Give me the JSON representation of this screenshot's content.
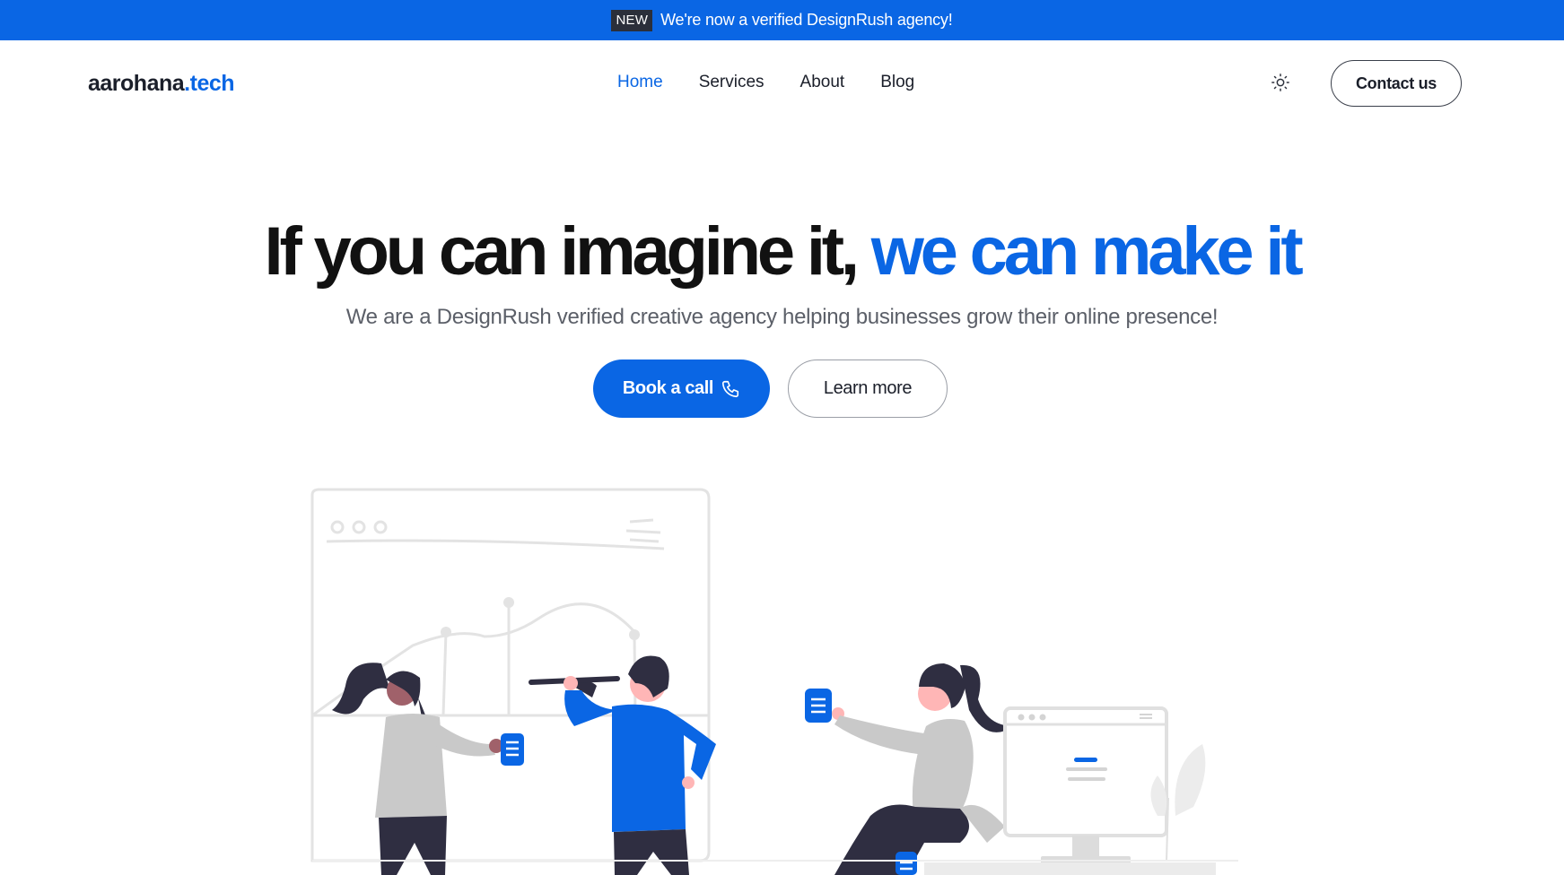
{
  "announcement": {
    "badge": "NEW",
    "message": "We're now a verified DesignRush agency!"
  },
  "header": {
    "logo_part1": "aarohana",
    "logo_part2": ".tech",
    "nav": [
      {
        "label": "Home",
        "active": true
      },
      {
        "label": "Services",
        "active": false
      },
      {
        "label": "About",
        "active": false
      },
      {
        "label": "Blog",
        "active": false
      }
    ],
    "theme_toggle_icon": "sun-icon",
    "contact_label": "Contact us"
  },
  "hero": {
    "title_part1": "If you can imagine it,",
    "title_part2": "we can make it",
    "subtitle": "We are a DesignRush verified creative agency helping businesses grow their online presence!",
    "primary_button": "Book a call",
    "primary_button_icon": "phone-icon",
    "secondary_button": "Learn more"
  },
  "colors": {
    "accent": "#0a66e4",
    "text_dark": "#111111",
    "text_muted": "#5b5f68",
    "illustration_gray": "#d9d9d9",
    "illustration_dark": "#2f2e41"
  }
}
